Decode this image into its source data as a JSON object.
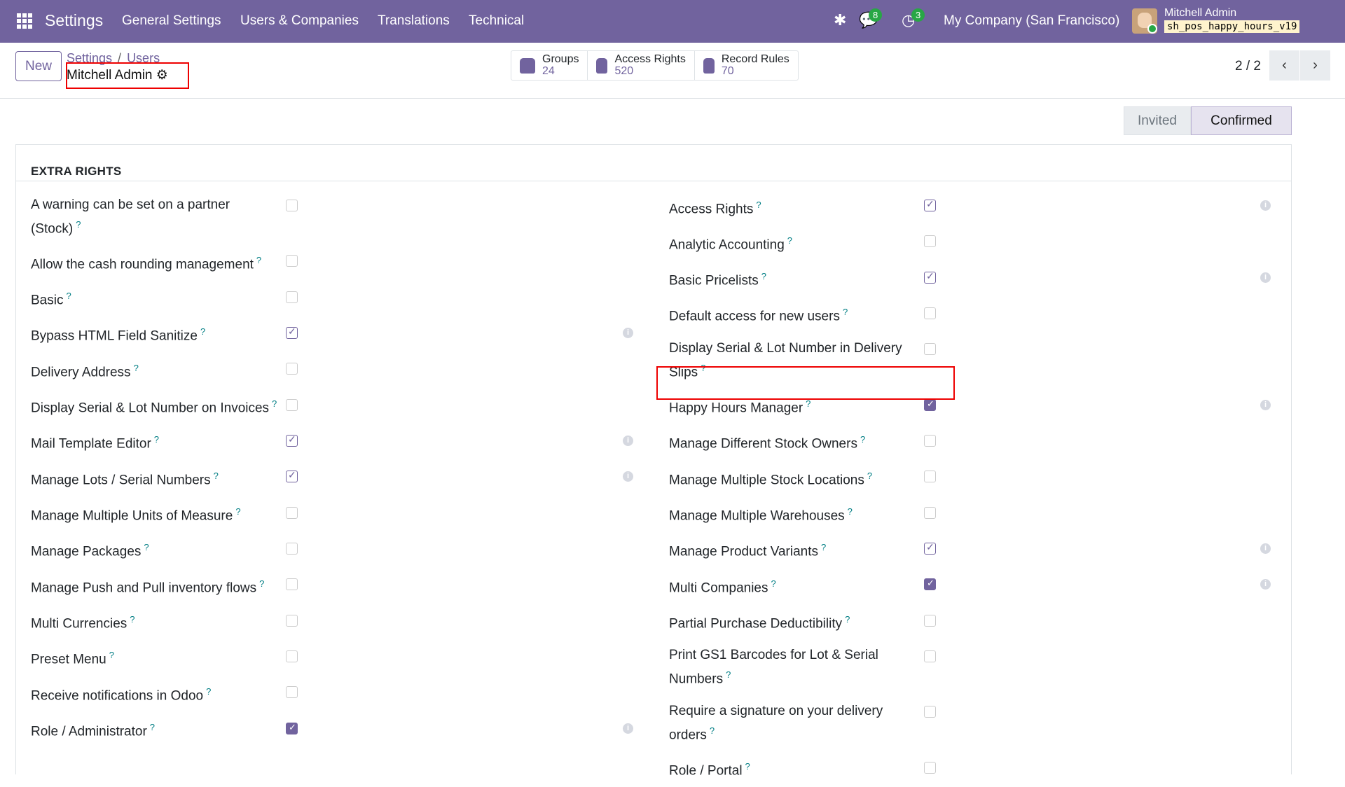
{
  "navbar": {
    "app": "Settings",
    "menu": [
      "General Settings",
      "Users & Companies",
      "Translations",
      "Technical"
    ],
    "messages_badge": "8",
    "activities_badge": "3",
    "company": "My Company (San Francisco)",
    "user": "Mitchell Admin",
    "database": "sh_pos_happy_hours_v19"
  },
  "control": {
    "new_label": "New",
    "breadcrumb": [
      "Settings",
      "Users"
    ],
    "breadcrumb_sep": "/",
    "title": "Mitchell Admin",
    "stats": [
      {
        "label": "Groups",
        "value": "24"
      },
      {
        "label": "Access Rights",
        "value": "520"
      },
      {
        "label": "Record Rules",
        "value": "70"
      }
    ],
    "pager": "2 / 2"
  },
  "status": {
    "stages": [
      "Invited",
      "Confirmed"
    ],
    "current": "Confirmed"
  },
  "section": {
    "title": "EXTRA RIGHTS"
  },
  "help_mark": "?",
  "left": [
    {
      "label": "A warning can be set on a partner (Stock)",
      "state": "none"
    },
    {
      "label": "Allow the cash rounding management",
      "state": "none"
    },
    {
      "label": "Basic",
      "state": "none"
    },
    {
      "label": "Bypass HTML Field Sanitize",
      "state": "outline",
      "info": true
    },
    {
      "label": "Delivery Address",
      "state": "none"
    },
    {
      "label": "Display Serial & Lot Number on Invoices",
      "state": "none"
    },
    {
      "label": "Mail Template Editor",
      "state": "outline",
      "info": true
    },
    {
      "label": "Manage Lots / Serial Numbers",
      "state": "outline",
      "info": true
    },
    {
      "label": "Manage Multiple Units of Measure",
      "state": "none"
    },
    {
      "label": "Manage Packages",
      "state": "none"
    },
    {
      "label": "Manage Push and Pull inventory flows",
      "state": "none"
    },
    {
      "label": "Multi Currencies",
      "state": "none"
    },
    {
      "label": "Preset Menu",
      "state": "none"
    },
    {
      "label": "Receive notifications in Odoo",
      "state": "none"
    },
    {
      "label": "Role / Administrator",
      "state": "filled",
      "info": true
    }
  ],
  "right": [
    {
      "label": "Access Rights",
      "state": "outline",
      "info": true
    },
    {
      "label": "Analytic Accounting",
      "state": "none"
    },
    {
      "label": "Basic Pricelists",
      "state": "outline",
      "info": true
    },
    {
      "label": "Default access for new users",
      "state": "none"
    },
    {
      "label": "Display Serial & Lot Number in Delivery Slips",
      "state": "none"
    },
    {
      "label": "Happy Hours Manager",
      "state": "filled",
      "info": true
    },
    {
      "label": "Manage Different Stock Owners",
      "state": "none"
    },
    {
      "label": "Manage Multiple Stock Locations",
      "state": "none"
    },
    {
      "label": "Manage Multiple Warehouses",
      "state": "none"
    },
    {
      "label": "Manage Product Variants",
      "state": "outline",
      "info": true
    },
    {
      "label": "Multi Companies",
      "state": "filled",
      "info": true
    },
    {
      "label": "Partial Purchase Deductibility",
      "state": "none"
    },
    {
      "label": "Print GS1 Barcodes for Lot & Serial Numbers",
      "state": "none"
    },
    {
      "label": "Require a signature on your delivery orders",
      "state": "none"
    },
    {
      "label": "Role / Portal",
      "state": "none"
    }
  ],
  "colors": {
    "brand": "#71639e",
    "badge": "#28a745",
    "highlight": "#e00000"
  }
}
